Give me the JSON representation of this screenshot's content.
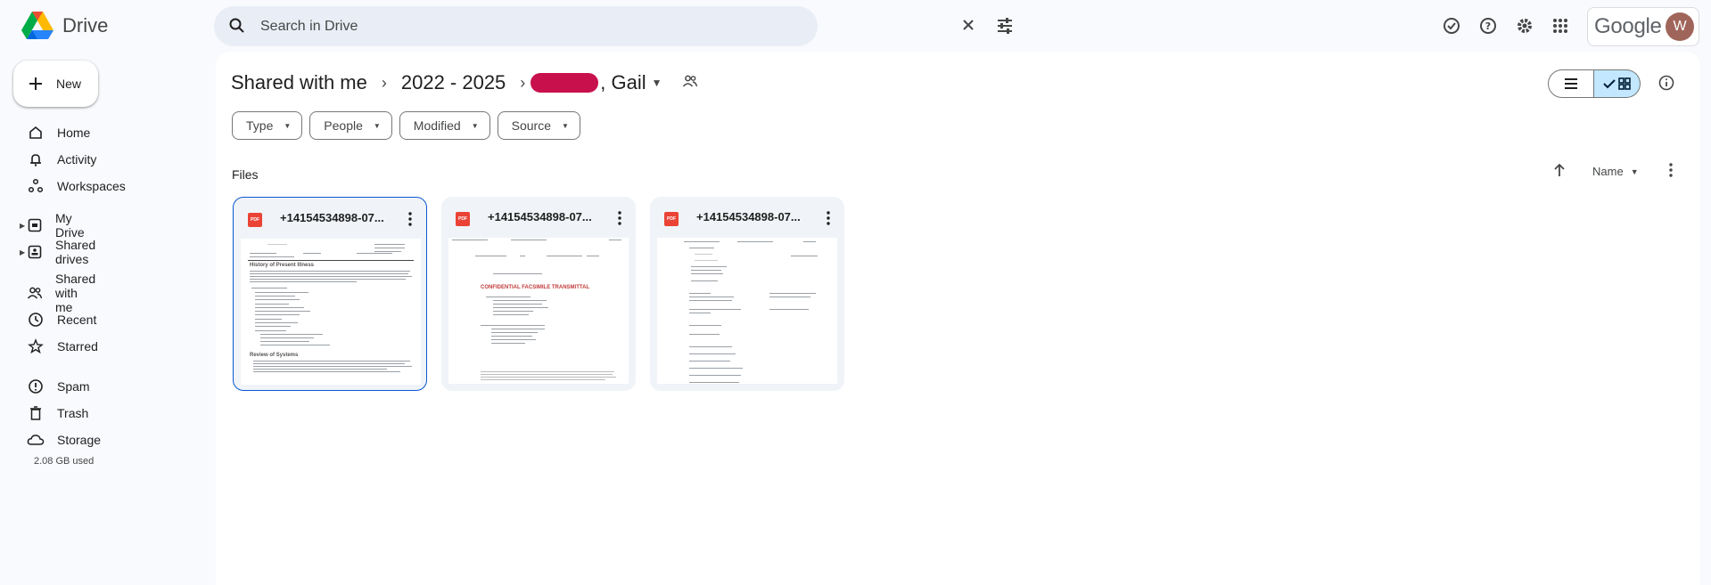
{
  "app": {
    "name": "Drive"
  },
  "search": {
    "placeholder": "Search in Drive"
  },
  "header": {
    "google_label": "Google",
    "avatar_initial": "W"
  },
  "sidebar": {
    "new_label": "New",
    "items": [
      {
        "label": "Home",
        "icon": "home-icon"
      },
      {
        "label": "Activity",
        "icon": "bell-icon"
      },
      {
        "label": "Workspaces",
        "icon": "workspaces-icon"
      },
      {
        "label": "My Drive",
        "icon": "my-drive-icon"
      },
      {
        "label": "Shared drives",
        "icon": "shared-drives-icon"
      },
      {
        "label": "Shared with me",
        "icon": "people-icon"
      },
      {
        "label": "Recent",
        "icon": "clock-icon"
      },
      {
        "label": "Starred",
        "icon": "star-icon"
      },
      {
        "label": "Spam",
        "icon": "spam-icon"
      },
      {
        "label": "Trash",
        "icon": "trash-icon"
      },
      {
        "label": "Storage",
        "icon": "cloud-icon"
      }
    ],
    "storage_used": "2.08 GB used"
  },
  "breadcrumb": {
    "items": [
      "Shared with me",
      "2022 - 2025"
    ],
    "current_suffix": ", Gail"
  },
  "filters": {
    "chips": [
      "Type",
      "People",
      "Modified",
      "Source"
    ]
  },
  "main": {
    "files_label": "Files",
    "sort_label": "Name"
  },
  "files": [
    {
      "name": "+14154534898-07...",
      "type": "PDF"
    },
    {
      "name": "+14154534898-07...",
      "type": "PDF"
    },
    {
      "name": "+14154534898-07...",
      "type": "PDF"
    }
  ],
  "thumbnails": {
    "t1_heading": "History of Present Illness",
    "t1_heading2": "Review of Systems",
    "t2_heading": "CONFIDENTIAL FACSIMILE TRANSMITTAL"
  },
  "colors": {
    "accent": "#0b57d0",
    "selected_toggle": "#c2e7ff",
    "pdf": "#ea4335"
  }
}
